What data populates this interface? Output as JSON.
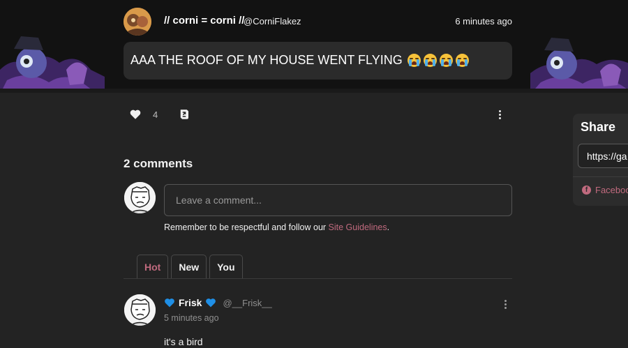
{
  "post": {
    "author": "// corni = corni //",
    "handle": "@CorniFlakez",
    "time": "6 minutes ago",
    "text": "AAA THE ROOF OF MY HOUSE WENT FLYING",
    "emoji_icon": "loudly-crying-face-icon",
    "emoji_count": 4,
    "like_count": "4"
  },
  "share": {
    "title": "Share",
    "url": "https://ga",
    "facebook_label": "Faceboo"
  },
  "comments": {
    "heading": "2 comments",
    "input_placeholder": "Leave a comment...",
    "guidelines_prefix": "Remember to be respectful and follow our ",
    "guidelines_link": "Site Guidelines",
    "guidelines_suffix": ".",
    "tabs": [
      {
        "label": "Hot",
        "active": true
      },
      {
        "label": "New",
        "active": false
      },
      {
        "label": "You",
        "active": false
      }
    ],
    "items": [
      {
        "author": "Frisk",
        "handle": "@__Frisk__",
        "time": "5 minutes ago",
        "text": "it's a bird",
        "badge_icon": "blue-heart-icon"
      }
    ]
  },
  "colors": {
    "accent": "#c06a7e",
    "background": "#232323",
    "bubble": "#2b2b2b",
    "blue_heart": "#1f8fe6"
  }
}
